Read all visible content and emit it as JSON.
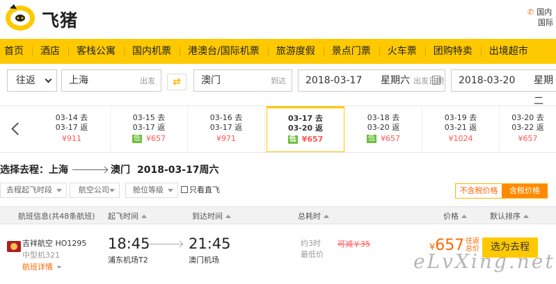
{
  "header": {
    "logo_text": "飞猪",
    "contact_lines": [
      "国内",
      "国际"
    ]
  },
  "nav": {
    "items": [
      "首页",
      "酒店",
      "客栈公寓",
      "国内机票",
      "港澳台/国际机票",
      "旅游度假",
      "景点门票",
      "火车票",
      "团购特卖",
      "出境超市"
    ]
  },
  "search": {
    "trip_type": "往返",
    "from_city": "上海",
    "from_hint": "出发",
    "to_city": "澳门",
    "to_hint": "到达",
    "depart_date": "2018-03-17",
    "depart_weekday": "星期六",
    "depart_hint": "出发日期",
    "return_date": "2018-03-20",
    "return_weekday": "星期二"
  },
  "date_tabs": [
    {
      "go": "03-14 去",
      "back": "03-17 返",
      "price": "¥911",
      "low": ""
    },
    {
      "go": "03-15 去",
      "back": "03-17 返",
      "price": "¥657",
      "low": "低"
    },
    {
      "go": "03-16 去",
      "back": "03-17 返",
      "price": "¥971",
      "low": ""
    },
    {
      "go": "03-17 去",
      "back": "03-20 返",
      "price": "¥657",
      "low": "低"
    },
    {
      "go": "03-18 去",
      "back": "03-20 返",
      "price": "¥657",
      "low": "低"
    },
    {
      "go": "03-19 去",
      "back": "03-21 返",
      "price": "¥1024",
      "low": ""
    },
    {
      "go": "03-20 去",
      "back": "03-22 返",
      "price": "¥657",
      "low": ""
    }
  ],
  "route": {
    "prefix": "选择去程：上海",
    "dest": "澳门",
    "date": "2018-03-17周六"
  },
  "filters": {
    "time_slot": "去程起飞时段",
    "airline": "航空公司",
    "cabin": "舱位等级",
    "direct": "只看直飞",
    "tax_excl": "不含税价格",
    "tax_incl": "含税价格"
  },
  "columns": {
    "flight_info": "航班信息(共48条航班)",
    "depart_time": "起飞时间",
    "arrive_time": "到达时间",
    "duration": "总耗时",
    "price": "价格",
    "sort": "默认排序"
  },
  "flight": {
    "airline": "吉祥航空 HO1295",
    "plane_type": "中型机321",
    "detail": "航班详情",
    "depart_time": "18:45",
    "depart_airport": "浦东机场T2",
    "arrive_time": "21:45",
    "arrive_airport": "澳门机场",
    "duration": "约3时",
    "price_note": "最低价",
    "discount": "可减￥35",
    "currency": "¥",
    "price": "657",
    "price_tag_1": "往返",
    "price_tag_2": "总价",
    "book_label": "选为去程"
  },
  "watermark": "eLvXing.net"
}
